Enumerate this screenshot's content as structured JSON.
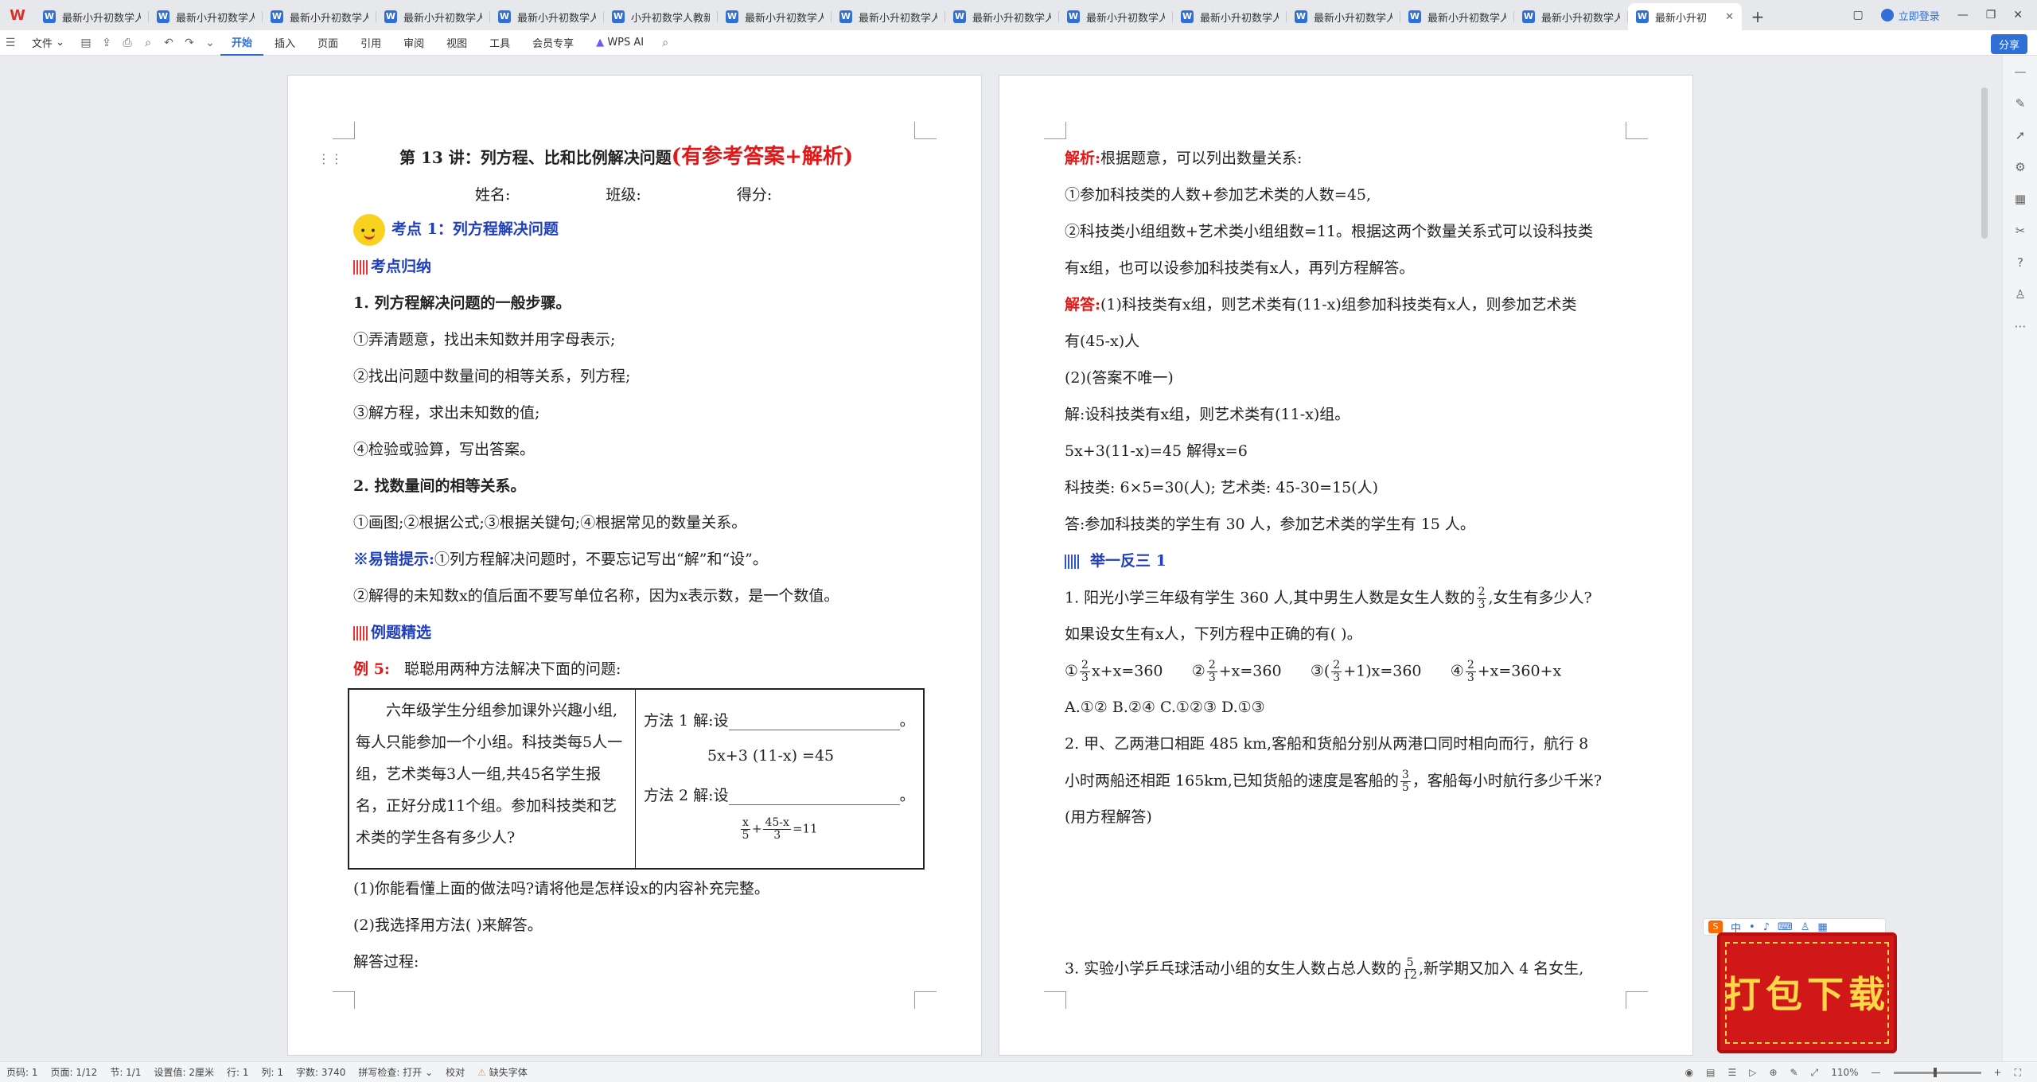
{
  "tabs": {
    "items": [
      {
        "label": "最新小升初数学人..."
      },
      {
        "label": "最新小升初数学人..."
      },
      {
        "label": "最新小升初数学人..."
      },
      {
        "label": "最新小升初数学人..."
      },
      {
        "label": "最新小升初数学人..."
      },
      {
        "label": "小升初数学人教新..."
      },
      {
        "label": "最新小升初数学人..."
      },
      {
        "label": "最新小升初数学人..."
      },
      {
        "label": "最新小升初数学人..."
      },
      {
        "label": "最新小升初数学人..."
      },
      {
        "label": "最新小升初数学人..."
      },
      {
        "label": "最新小升初数学人..."
      },
      {
        "label": "最新小升初数学人..."
      },
      {
        "label": "最新小升初数学人..."
      }
    ],
    "active_label": "最新小升初",
    "login": "立即登录"
  },
  "ribbon": {
    "file": "文件",
    "start": "开始",
    "insert": "插入",
    "page": "页面",
    "ref": "引用",
    "review": "审阅",
    "view": "视图",
    "tools": "工具",
    "member": "会员专享",
    "wpsai": "WPS AI",
    "share": "分享"
  },
  "page1": {
    "title": "第 13 讲：列方程、比和比例解决问题",
    "title_red": "(有参考答案+解析)",
    "name": "姓名:",
    "class": "班级:",
    "score": "得分:",
    "kaodian1": "考点 1：列方程解决问题",
    "guina": "考点归纳",
    "h1": "1. 列方程解决问题的一般步骤。",
    "s1": "①弄清题意，找出未知数并用字母表示;",
    "s2": "②找出问题中数量间的相等关系，列方程;",
    "s3": "③解方程，求出未知数的值;",
    "s4": "④检验或验算，写出答案。",
    "h2": "2. 找数量间的相等关系。",
    "s5": "①画图;②根据公式;③根据关键句;④根据常见的数量关系。",
    "tip_label": "※易错提示:",
    "tip_text": "①列方程解决问题时，不要忘记写出“解”和“设”。",
    "tip2": "②解得的未知数x的值后面不要写单位名称，因为x表示数，是一个数值。",
    "lijing": "例题精选",
    "ex_label": "例 5:",
    "ex_text": "聪聪用两种方法解决下面的问题:",
    "table_left": "六年级学生分组参加课外兴趣小组,每人只能参加一个小组。科技类每5人一组，艺术类每3人一组,共45名学生报名，正好分成11个组。参加科技类和艺术类的学生各有多少人?",
    "m1": "方法 1  解:设",
    "m1_eq": "5x+3 (11-x) =45",
    "m2": "方法 2  解:设",
    "m2_eq_num1": "x",
    "m2_eq_den1": "5",
    "m2_eq_num2": "45-x",
    "m2_eq_den2": "3",
    "m2_eq_rest": "=11",
    "q1": "(1)你能看懂上面的做法吗?请将他是怎样设x的内容补充完整。",
    "q2": "(2)我选择用方法(        )来解答。",
    "q3": "解答过程:"
  },
  "page2": {
    "jx_label": "解析:",
    "jx_text": "根据题意，可以列出数量关系:",
    "a1": "①参加科技类的人数+参加艺术类的人数=45,",
    "a2": "②科技类小组组数+艺术类小组组数=11。根据这两个数量关系式可以设科技类",
    "a3": "有x组，也可以设参加科技类有x人，再列方程解答。",
    "jd_label": "解答:",
    "jd_text": "(1)科技类有x组，则艺术类有(11-x)组参加科技类有x人，则参加艺术类",
    "a4": "有(45-x)人",
    "a5": "(2)(答案不唯一)",
    "a6": "解:设科技类有x组，则艺术类有(11-x)组。",
    "a7": "5x+3(11-x)=45        解得x=6",
    "a8": "科技类: 6×5=30(人); 艺术类: 45-30=15(人)",
    "a9": "答:参加科技类的学生有 30 人，参加艺术类的学生有 15 人。",
    "jyfs": "举一反三 1",
    "p1a": "1. 阳光小学三年级有学生 360 人,其中男生人数是女生人数的",
    "p1_num": "2",
    "p1_den": "3",
    "p1b": ",女生有多少人?",
    "p1c": "如果设女生有x人，下列方程中正确的有(      )。",
    "opt1": "①",
    "opt1b": "x+x=360",
    "opt2": "②",
    "opt2b": "+x=360",
    "opt3": "③(",
    "opt3b": "+1)x=360",
    "opt4": "④",
    "opt4b": "+x=360+x",
    "choices": "A.①②        B.②④        C.①②③        D.①③",
    "p2a": "2. 甲、乙两港口相距 485 km,客船和货船分别从两港口同时相向而行，航行 8",
    "p2b": "小时两船还相距 165km,已知货船的速度是客船的",
    "p2_num": "3",
    "p2_den": "5",
    "p2c": "，客船每小时航行多少千米?",
    "p2d": "(用方程解答)",
    "p3a": "3. 实验小学乒乓球活动小组的女生人数占总人数的",
    "p3_num": "5",
    "p3_den": "12",
    "p3b": ",新学期又加入 4 名女生,"
  },
  "statusbar": {
    "page": "页码: 1",
    "pages": "页面: 1/12",
    "section": "节: 1/1",
    "setting": "设置值: 2厘米",
    "row": "行: 1",
    "col": "列: 1",
    "words": "字数: 3740",
    "spell": "拼写检查: 打开",
    "proof": "校对",
    "font": "缺失字体",
    "zoom": "110%"
  },
  "banner": {
    "text": "打包下载"
  },
  "ime": {
    "label": "中"
  }
}
